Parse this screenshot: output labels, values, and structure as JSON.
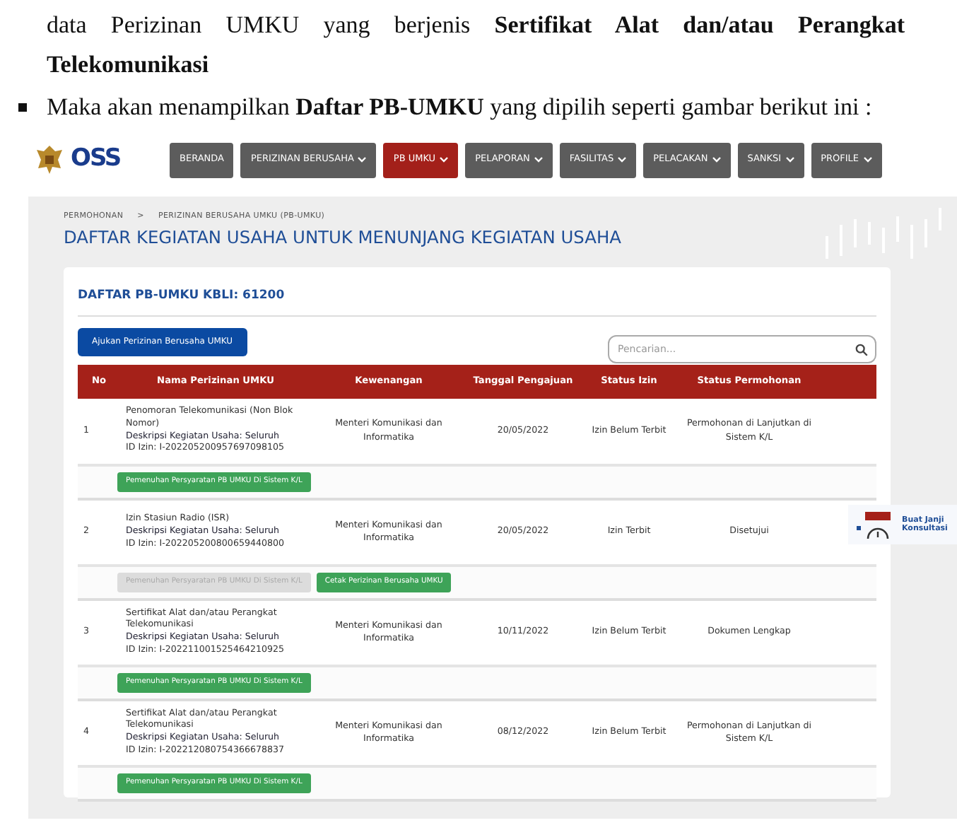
{
  "document": {
    "paragraph": "data Perizinan UMKU yang berjenis **Sertifikat Alat dan/atau Perangkat Telekomunikasi**",
    "bullet": "Maka akan menampilkan **Daftar PB-UMKU** yang dipilih seperti gambar berikut ini :"
  },
  "navbar": {
    "logo": "OSS",
    "items": [
      {
        "label": "BERANDA",
        "dropdown": false,
        "selected": false
      },
      {
        "label": "PERIZINAN BERUSAHA",
        "dropdown": true,
        "selected": false
      },
      {
        "label": "PB UMKU",
        "dropdown": true,
        "selected": true
      },
      {
        "label": "PELAPORAN",
        "dropdown": true,
        "selected": false
      },
      {
        "label": "FASILITAS",
        "dropdown": true,
        "selected": false
      },
      {
        "label": "PELACAKAN",
        "dropdown": true,
        "selected": false
      },
      {
        "label": "SANKSI",
        "dropdown": true,
        "selected": false
      },
      {
        "label": "PROFILE",
        "dropdown": true,
        "selected": false
      }
    ]
  },
  "breadcrumb": [
    "PERMOHONAN",
    ">",
    "PERIZINAN BERUSAHA UMKU (PB-UMKU)"
  ],
  "page_title": "DAFTAR KEGIATAN USAHA UNTUK MENUNJANG KEGIATAN USAHA",
  "card": {
    "title": "DAFTAR PB-UMKU KBLI: 61200",
    "submit_button": "Ajukan Perizinan Berusaha UMKU",
    "search": {
      "placeholder": "Pencarian..."
    }
  },
  "table": {
    "columns": [
      "No",
      "Nama Perizinan UMKU",
      "Kewenangan",
      "Tanggal Pengajuan",
      "Status Izin",
      "Status Permohonan"
    ],
    "rows": [
      {
        "no": "1",
        "name": "Penomoran Telekomunikasi (Non Blok Nomor)",
        "description": "Deskripsi Kegiatan Usaha: Seluruh",
        "id": "ID Izin: I-202205200957697098105",
        "authority": "Menteri Komunikasi dan Informatika",
        "date": "20/05/2022",
        "status_izin": "Izin Belum Terbit",
        "status_permohonan": "Permohonan di Lanjutkan di Sistem K/L",
        "actions": [
          {
            "label": "Pemenuhan Persyaratan PB UMKU Di Sistem K/L",
            "disabled": false
          }
        ]
      },
      {
        "no": "2",
        "name": "Izin Stasiun Radio (ISR)",
        "description": "Deskripsi Kegiatan Usaha: Seluruh",
        "id": "ID Izin: I-202205200800659440800",
        "authority": "Menteri Komunikasi dan Informatika",
        "date": "20/05/2022",
        "status_izin": "Izin Terbit",
        "status_permohonan": "Disetujui",
        "actions": [
          {
            "label": "Pemenuhan Persyaratan PB UMKU Di Sistem K/L",
            "disabled": true
          },
          {
            "label": "Cetak Perizinan Berusaha UMKU",
            "disabled": false
          }
        ]
      },
      {
        "no": "3",
        "name": "Sertifikat Alat dan/atau Perangkat Telekomunikasi",
        "description": "Deskripsi Kegiatan Usaha: Seluruh",
        "id": "ID Izin: I-202211001525464210925",
        "authority": "Menteri Komunikasi dan Informatika",
        "date": "10/11/2022",
        "status_izin": "Izin Belum Terbit",
        "status_permohonan": "Dokumen Lengkap",
        "actions": [
          {
            "label": "Pemenuhan Persyaratan PB UMKU Di Sistem K/L",
            "disabled": false
          }
        ]
      },
      {
        "no": "4",
        "name": "Sertifikat Alat dan/atau Perangkat Telekomunikasi",
        "description": "Deskripsi Kegiatan Usaha: Seluruh",
        "id": "ID Izin: I-202212080754366678837",
        "authority": "Menteri Komunikasi dan Informatika",
        "date": "08/12/2022",
        "status_izin": "Izin Belum Terbit",
        "status_permohonan": "Permohonan di Lanjutkan di Sistem K/L",
        "actions": [
          {
            "label": "Pemenuhan Persyaratan PB UMKU Di Sistem K/L",
            "disabled": false
          }
        ]
      }
    ]
  },
  "consult_widget": "Buat Janji Konsultasi"
}
